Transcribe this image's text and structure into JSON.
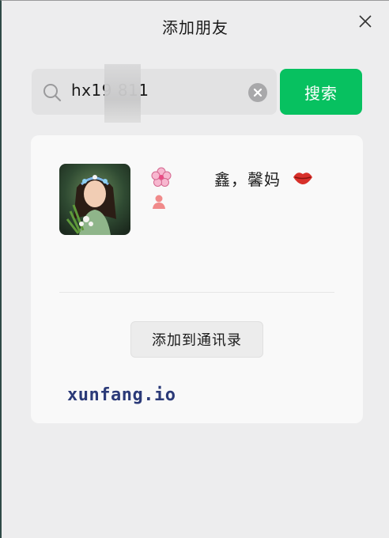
{
  "dialog": {
    "title": "添加朋友"
  },
  "search": {
    "value": "hx19    811",
    "button_label": "搜索"
  },
  "result": {
    "nickname": "鑫，馨妈",
    "add_button_label": "添加到通讯录",
    "watermark": "xunfang.io"
  },
  "colors": {
    "accent": "#07c160",
    "background": "#ededee",
    "card": "#f9f9f9",
    "watermark": "#2b3a78"
  },
  "icons": {
    "close": "close-icon",
    "search": "search-icon",
    "clear": "clear-icon",
    "flower": "cherry-blossom-icon",
    "lips": "lips-icon",
    "gender": "female-icon"
  }
}
